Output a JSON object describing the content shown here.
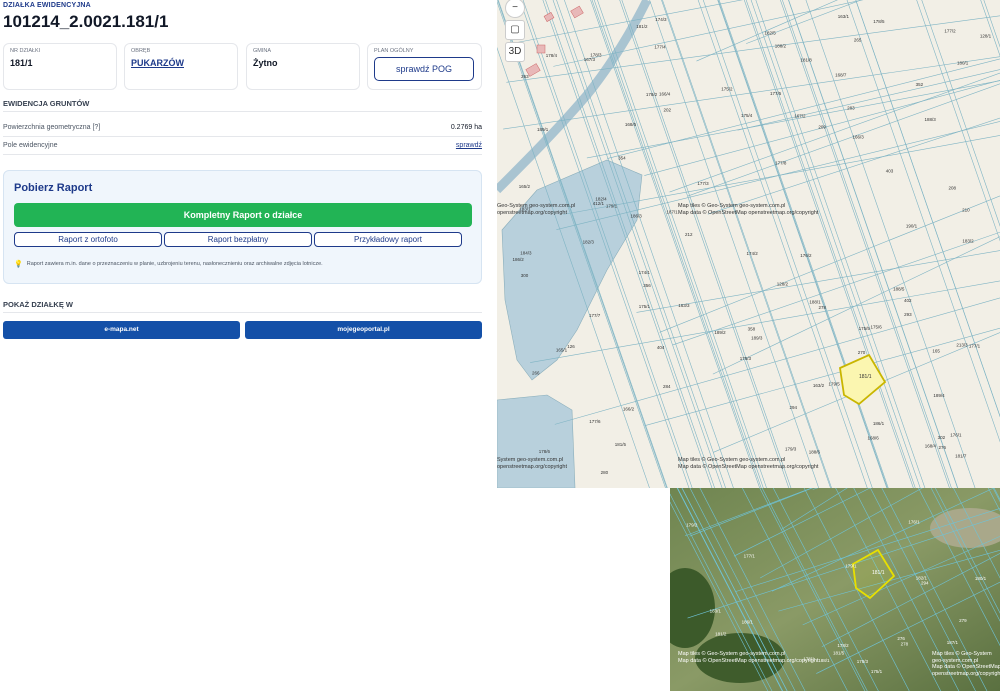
{
  "header": {
    "subtitle": "DZIAŁKA EWIDENCYJNA",
    "title": "101214_2.0021.181/1"
  },
  "cards": {
    "nr": {
      "label": "NR DZIAŁKI",
      "value": "181/1"
    },
    "obreb": {
      "label": "OBRĘB",
      "value": "PUKARZÓW"
    },
    "gmina": {
      "label": "GMINA",
      "value": "Żytno"
    },
    "plan": {
      "label": "PLAN OGÓLNY",
      "button": "sprawdź POG"
    }
  },
  "ewidencja": {
    "heading": "EWIDENCJA GRUNTÓW",
    "rows": [
      {
        "label": "Powierzchnia geometryczna [?]",
        "value": "0.2769 ha"
      },
      {
        "label": "Pole ewidencyjne",
        "value": "sprawdź"
      }
    ]
  },
  "report": {
    "title": "Pobierz Raport",
    "main_button": "Kompletny Raport o działce",
    "buttons": [
      "Raport z ortofoto",
      "Raport bezpłatny",
      "Przykładowy raport"
    ],
    "note": "Raport zawiera m.in. dane o przeznaczeniu w planie, uzbrojeniu terenu, nasłonecznieniu oraz archiwalne zdjęcia lotnicze."
  },
  "show": {
    "heading": "POKAŻ DZIAŁKĘ W",
    "buttons": [
      "e-mapa.net",
      "mojegeoportal.pl"
    ]
  },
  "map": {
    "controls": {
      "zoom_out": "−",
      "layers": "▢",
      "view3d": "3D"
    },
    "attribution_1": "Map tiles © Geo-System geo-system.com.pl",
    "attribution_2": "Map data © OpenStreetMap openstreetmap.org/copyright",
    "attribution_left_1": "Geo-System geo-system.com.pl",
    "attribution_left_2": "openstreetmap.org/copyright",
    "attribution_small_1": "System geo-system.com.pl",
    "attribution_small_2": "openstreetmap.org/copyright",
    "highlight_label": "181/1",
    "parcel_labels": [
      "202",
      "208",
      "209",
      "210",
      "212",
      "213/3",
      "163/3",
      "163/1",
      "165",
      "352",
      "354",
      "402",
      "403",
      "404",
      "165/1",
      "174/2",
      "174/1",
      "165/2",
      "174/3",
      "175/2",
      "176/1",
      "177/5",
      "177/6",
      "177/7",
      "177/8",
      "178/5",
      "178/6",
      "179/5",
      "179/3",
      "180/1",
      "181/5",
      "181/7",
      "182/3",
      "182/5",
      "182/4",
      "183/1",
      "183/2",
      "188/1",
      "188/3",
      "188/5",
      "188/6",
      "189/1",
      "189/2",
      "189/3",
      "189/4",
      "167/3",
      "167/2",
      "166/3",
      "166/4",
      "166/2",
      "168/4",
      "168/5",
      "168/6",
      "168/7",
      "175/1",
      "175/3",
      "175/4",
      "175/5",
      "175/6",
      "176/2",
      "177/1",
      "177/2",
      "177/3",
      "177/4",
      "178/2",
      "178/3",
      "178/4",
      "179/1",
      "181/2",
      "181/8",
      "182/1",
      "184/3",
      "186/3",
      "186/2",
      "186/1",
      "187/1",
      "188/2",
      "190/1",
      "412/1",
      "128/1",
      "128/2",
      "126",
      "163/2",
      "356",
      "358",
      "293",
      "284",
      "278",
      "276",
      "300",
      "302",
      "280",
      "283",
      "294",
      "263",
      "265",
      "266",
      "270"
    ],
    "sat_labels": [
      "178/1",
      "178/2",
      "179/1",
      "179/2",
      "180/1",
      "181/2",
      "181/5",
      "183/1",
      "182/1",
      "177/1",
      "186/1",
      "187/1",
      "188/1",
      "175/1",
      "176/1",
      "178/3",
      "276",
      "278",
      "279",
      "294"
    ],
    "sat_attr_1": "Map tiles © Geo-System geo-system.com.pl",
    "sat_attr_2": "Map data © OpenStreetMap openstreetmap.org/copyright"
  }
}
